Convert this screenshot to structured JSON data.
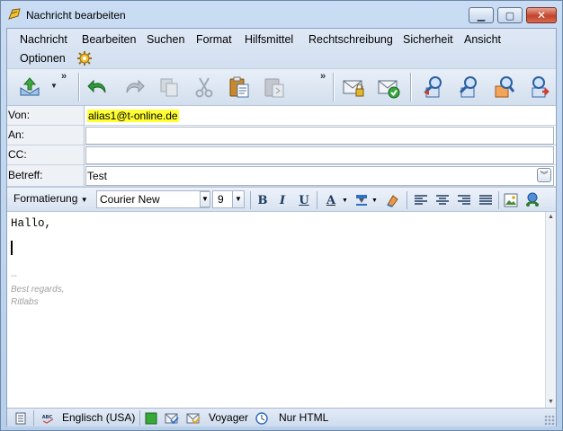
{
  "window": {
    "title": "Nachricht bearbeiten"
  },
  "menubar": {
    "items": [
      "Nachricht",
      "Bearbeiten",
      "Suchen",
      "Format",
      "Hilfsmittel",
      "Rechtschreibung",
      "Sicherheit",
      "Ansicht",
      "Optionen"
    ]
  },
  "toolbar": {
    "icons": [
      "send-icon",
      "undo-icon",
      "redo-icon",
      "copy-icon",
      "cut-icon",
      "paste-icon",
      "paste-special-icon",
      "sign-mail-icon",
      "encrypt-mail-icon",
      "address-icon"
    ],
    "overflow": "»"
  },
  "header": {
    "from_label": "Von:",
    "from_value": "alias1@t-online.de",
    "to_label": "An:",
    "to_value": "",
    "cc_label": "CC:",
    "cc_value": "",
    "subject_label": "Betreff:",
    "subject_value": "Test"
  },
  "formatbar": {
    "format_label": "Formatierung",
    "font": "Courier New",
    "size": "9",
    "bold": "B",
    "italic": "I",
    "underline": "U",
    "font_color": "A"
  },
  "editor": {
    "body": "Hallo,",
    "signature_lines": [
      "--",
      "Best regards,",
      "Ritlabs"
    ]
  },
  "statusbar": {
    "language": "Englisch (USA)",
    "app": "Voyager",
    "mode": "Nur HTML"
  },
  "colors": {
    "highlight": "#ffff33",
    "accent": "#2f6fc6",
    "titlebar": "#c9dcf3"
  }
}
